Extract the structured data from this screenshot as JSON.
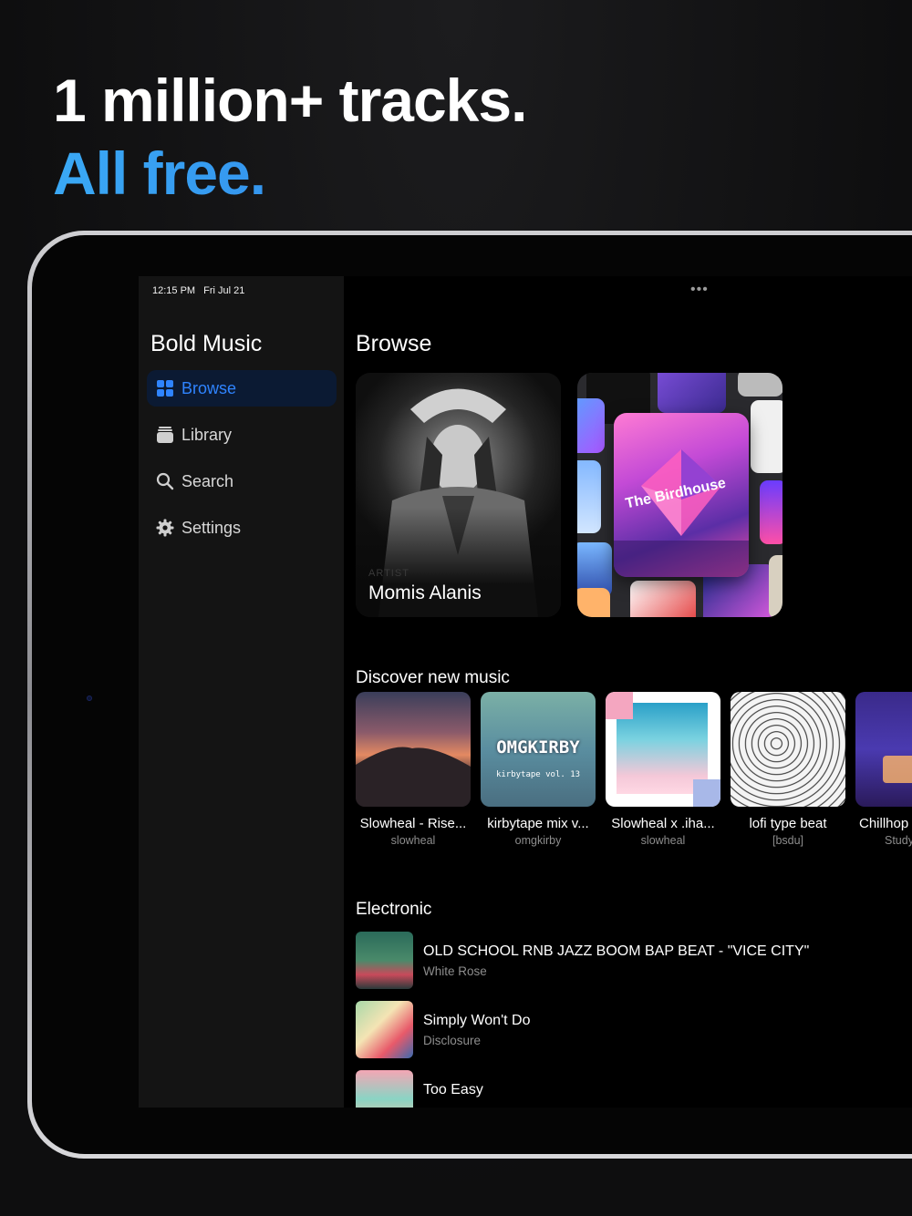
{
  "headline": {
    "line1": "1 million+ tracks.",
    "line2": "All free."
  },
  "status_bar": {
    "time": "12:15 PM",
    "date": "Fri Jul 21"
  },
  "sidebar": {
    "app_title": "Bold Music",
    "items": [
      {
        "label": "Browse",
        "icon": "grid-icon",
        "active": true
      },
      {
        "label": "Library",
        "icon": "library-stack-icon",
        "active": false
      },
      {
        "label": "Search",
        "icon": "search-icon",
        "active": false
      },
      {
        "label": "Settings",
        "icon": "gear-icon",
        "active": false
      }
    ]
  },
  "main": {
    "more_menu": "•••",
    "title": "Browse",
    "featured": [
      {
        "tag": "ARTIST",
        "name": "Momis Alanis"
      },
      {
        "playlist_title": "The Birdhouse"
      }
    ],
    "discover": {
      "title": "Discover new music",
      "albums": [
        {
          "title": "Slowheal - Rise...",
          "artist": "slowheal"
        },
        {
          "title": "kirbytape mix v...",
          "artist": "omgkirby",
          "art_text": "OMGKIRBY",
          "art_sub": "kirbytape vol. 13"
        },
        {
          "title": "Slowheal x .iha...",
          "artist": "slowheal"
        },
        {
          "title": "lofi type beat",
          "artist": "[bsdu]"
        },
        {
          "title": "Chillhop",
          "artist": "Study"
        }
      ]
    },
    "electronic": {
      "title": "Electronic",
      "tracks": [
        {
          "title": "OLD SCHOOL RNB JAZZ BOOM BAP BEAT - \"VICE CITY\"",
          "artist": "White Rose"
        },
        {
          "title": "Simply Won't Do",
          "artist": "Disclosure"
        },
        {
          "title": "Too Easy",
          "artist": ""
        }
      ]
    }
  },
  "colors": {
    "accent": "#2f84ff",
    "headline_blue": "#3aa9f5",
    "sidebar_bg": "#141414",
    "active_bg": "#0b1a33"
  }
}
